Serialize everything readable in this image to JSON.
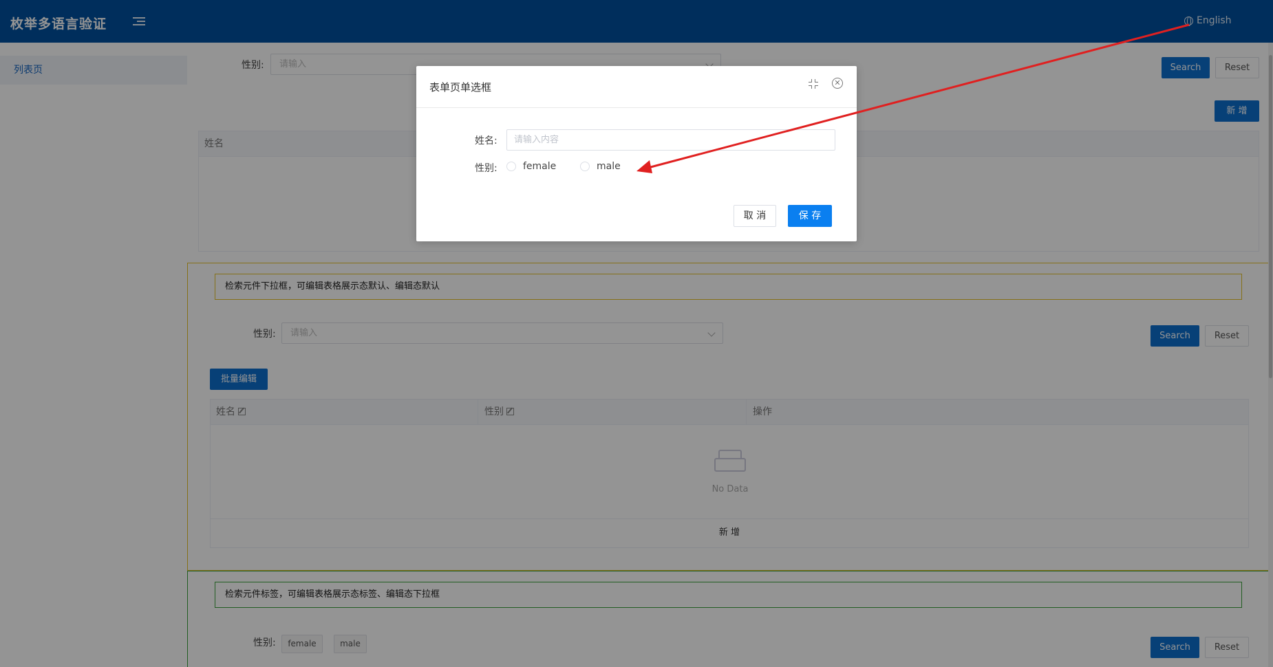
{
  "header": {
    "app_title": "枚举多语言验证",
    "language": "English"
  },
  "sidebar": {
    "items": [
      {
        "label": "列表页"
      }
    ]
  },
  "section1": {
    "filter_label": "性别:",
    "filter_placeholder": "请输入",
    "search": "Search",
    "reset": "Reset",
    "add": "新 增",
    "table_columns": [
      "姓名"
    ]
  },
  "section2": {
    "note": "检索元件下拉框，可编辑表格展示态默认、编辑态默认",
    "filter_label": "性别:",
    "filter_placeholder": "请输入",
    "search": "Search",
    "reset": "Reset",
    "batch_edit": "批量编辑",
    "table_columns": [
      "姓名",
      "性别",
      "操作"
    ],
    "empty_text": "No Data",
    "add_row": "新 增"
  },
  "section3": {
    "note": "检索元件标签，可编辑表格展示态标签、编辑态下拉框",
    "filter_label": "性别:",
    "tags": [
      "female",
      "male"
    ],
    "search": "Search",
    "reset": "Reset"
  },
  "dialog": {
    "title": "表单页单选框",
    "name_label": "姓名:",
    "name_placeholder": "请输入内容",
    "gender_label": "性别:",
    "options": [
      "female",
      "male"
    ],
    "cancel": "取 消",
    "save": "保 存"
  },
  "colors": {
    "header": "#00509f",
    "primary": "#0d6ecd",
    "annotation_arrow": "#e02020",
    "section2_border": "#e6c229",
    "section3_border": "#3aa13a"
  }
}
